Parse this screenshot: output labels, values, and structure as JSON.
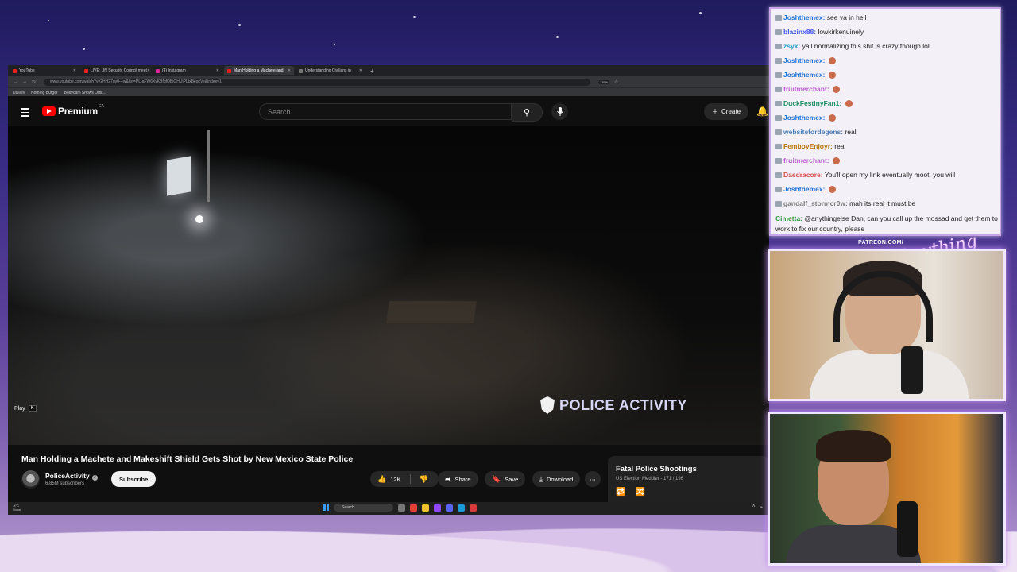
{
  "browser": {
    "tabs": [
      {
        "label": "YouTube",
        "active": false
      },
      {
        "label": "LIVE: UN Security Council meet",
        "active": false
      },
      {
        "label": "(4) Instagram",
        "active": false
      },
      {
        "label": "Man Holding a Machete and",
        "active": true
      },
      {
        "label": "Understanding Civilians in",
        "active": false
      }
    ],
    "new_tab": "+",
    "url": "www.youtube.com/watch?v=2HH27gy0---w&list=PL-aFW6XyKBfqfOBiGHUiPLtxBegcVe&index=1",
    "zoom": "110%",
    "bookmarks": [
      "Dailies",
      "Nothing Burger",
      "Bodycam Shows Offic..."
    ]
  },
  "youtube": {
    "brand": "Premium",
    "country": "CA",
    "search_placeholder": "Search",
    "create_label": "Create",
    "video": {
      "watermark": "POLICE ACTIVITY",
      "play_hint": "Play",
      "play_key": "K"
    },
    "title": "Man Holding a Machete and Makeshift Shield Gets Shot by New Mexico State Police",
    "channel": {
      "name": "PoliceActivity",
      "subscribers": "6.85M subscribers",
      "subscribe_label": "Subscribe"
    },
    "actions": {
      "likes": "12K",
      "share": "Share",
      "save": "Save",
      "download": "Download"
    },
    "playlist": {
      "title": "Fatal Police Shootings",
      "subtitle": "US Election Meddler - 171 / 196"
    }
  },
  "taskbar": {
    "weather_temp": "-4°C",
    "weather_cond": "Snow",
    "search_label": "Search"
  },
  "chat": {
    "messages": [
      {
        "user": "Joshthemex:",
        "text": "see ya in hell",
        "color": "#1e73d8"
      },
      {
        "user": "blazinx88:",
        "text": "lowkirkenuinely",
        "color": "#3b55e6"
      },
      {
        "user": "zsyk:",
        "text": "yall normalizing this shit is crazy though lol",
        "color": "#2aa0c9"
      },
      {
        "user": "Joshthemex:",
        "text": "",
        "color": "#1e73d8"
      },
      {
        "user": "Joshthemex:",
        "text": "",
        "color": "#1e73d8"
      },
      {
        "user": "fruitmerchant:",
        "text": "",
        "color": "#c05ad8"
      },
      {
        "user": "DuckFestinyFan1:",
        "text": "",
        "color": "#1e8f62"
      },
      {
        "user": "Joshthemex:",
        "text": "",
        "color": "#1e73d8"
      },
      {
        "user": "websitefordegens:",
        "text": "real",
        "color": "#4b7fb8"
      },
      {
        "user": "FemboyEnjoyr:",
        "text": "real",
        "color": "#b8770a"
      },
      {
        "user": "fruitmerchant:",
        "text": "",
        "color": "#c05ad8"
      },
      {
        "user": "Daedracore:",
        "text": "You'll open my link eventually moot. you will",
        "color": "#d64a4a"
      },
      {
        "user": "Joshthemex:",
        "text": "",
        "color": "#1e73d8"
      },
      {
        "user": "gandalf_stormcr0w:",
        "text": "mah its real it must be",
        "color": "#7a7a7a"
      },
      {
        "user": "Cimetta:",
        "text": "@anythingelse Dan, can you call up the mossad and get them to work to fix our country, please",
        "color": "#2a9e3a"
      }
    ]
  },
  "overlay": {
    "patreon": "PATREON.COM/",
    "script_logo": "Anything Else?"
  }
}
